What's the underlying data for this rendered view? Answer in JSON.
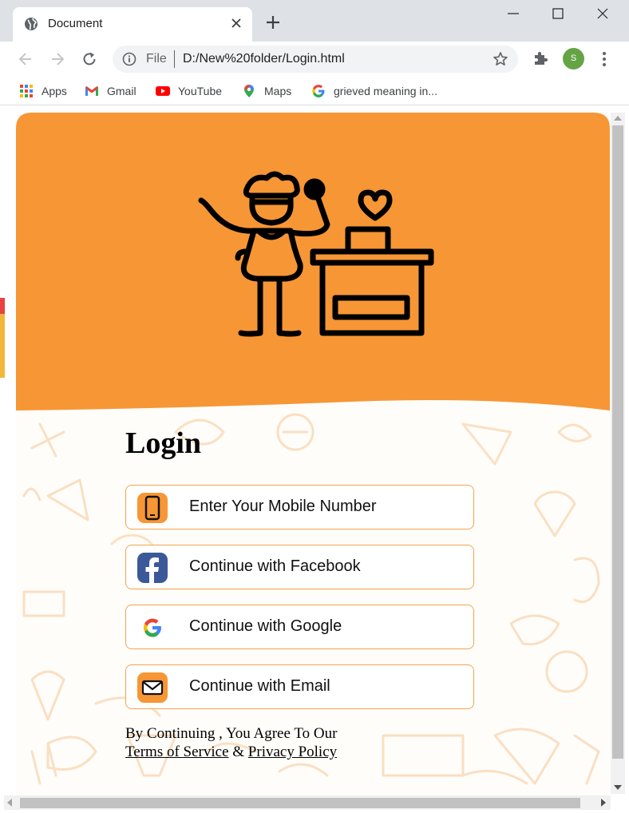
{
  "browser": {
    "tab_title": "Document",
    "url_scheme": "File",
    "url": "D:/New%20folder/Login.html",
    "avatar_letter": "S",
    "bookmarks": [
      {
        "label": "Apps",
        "icon": "apps-grid-icon"
      },
      {
        "label": "Gmail",
        "icon": "gmail-icon"
      },
      {
        "label": "YouTube",
        "icon": "youtube-icon"
      },
      {
        "label": "Maps",
        "icon": "maps-icon"
      },
      {
        "label": "grieved meaning in...",
        "icon": "google-icon"
      }
    ]
  },
  "login": {
    "heading": "Login",
    "buttons": {
      "mobile": {
        "label": "Enter Your Mobile Number",
        "icon": "mobile-phone-icon"
      },
      "facebook": {
        "label": "Continue with Facebook",
        "icon": "facebook-icon"
      },
      "google": {
        "label": "Continue with Google",
        "icon": "google-icon"
      },
      "email": {
        "label": "Continue with Email",
        "icon": "email-envelope-icon"
      }
    },
    "terms": {
      "prefix": "By Continuing , You Agree To Our",
      "tos_link": "Terms of Service",
      "conjunction": "&",
      "privacy_link": "Privacy Policy"
    }
  },
  "colors": {
    "hero_orange": "#f79634",
    "button_border": "#f0a64a",
    "facebook_blue": "#3b5998",
    "avatar_green": "#64a445"
  }
}
